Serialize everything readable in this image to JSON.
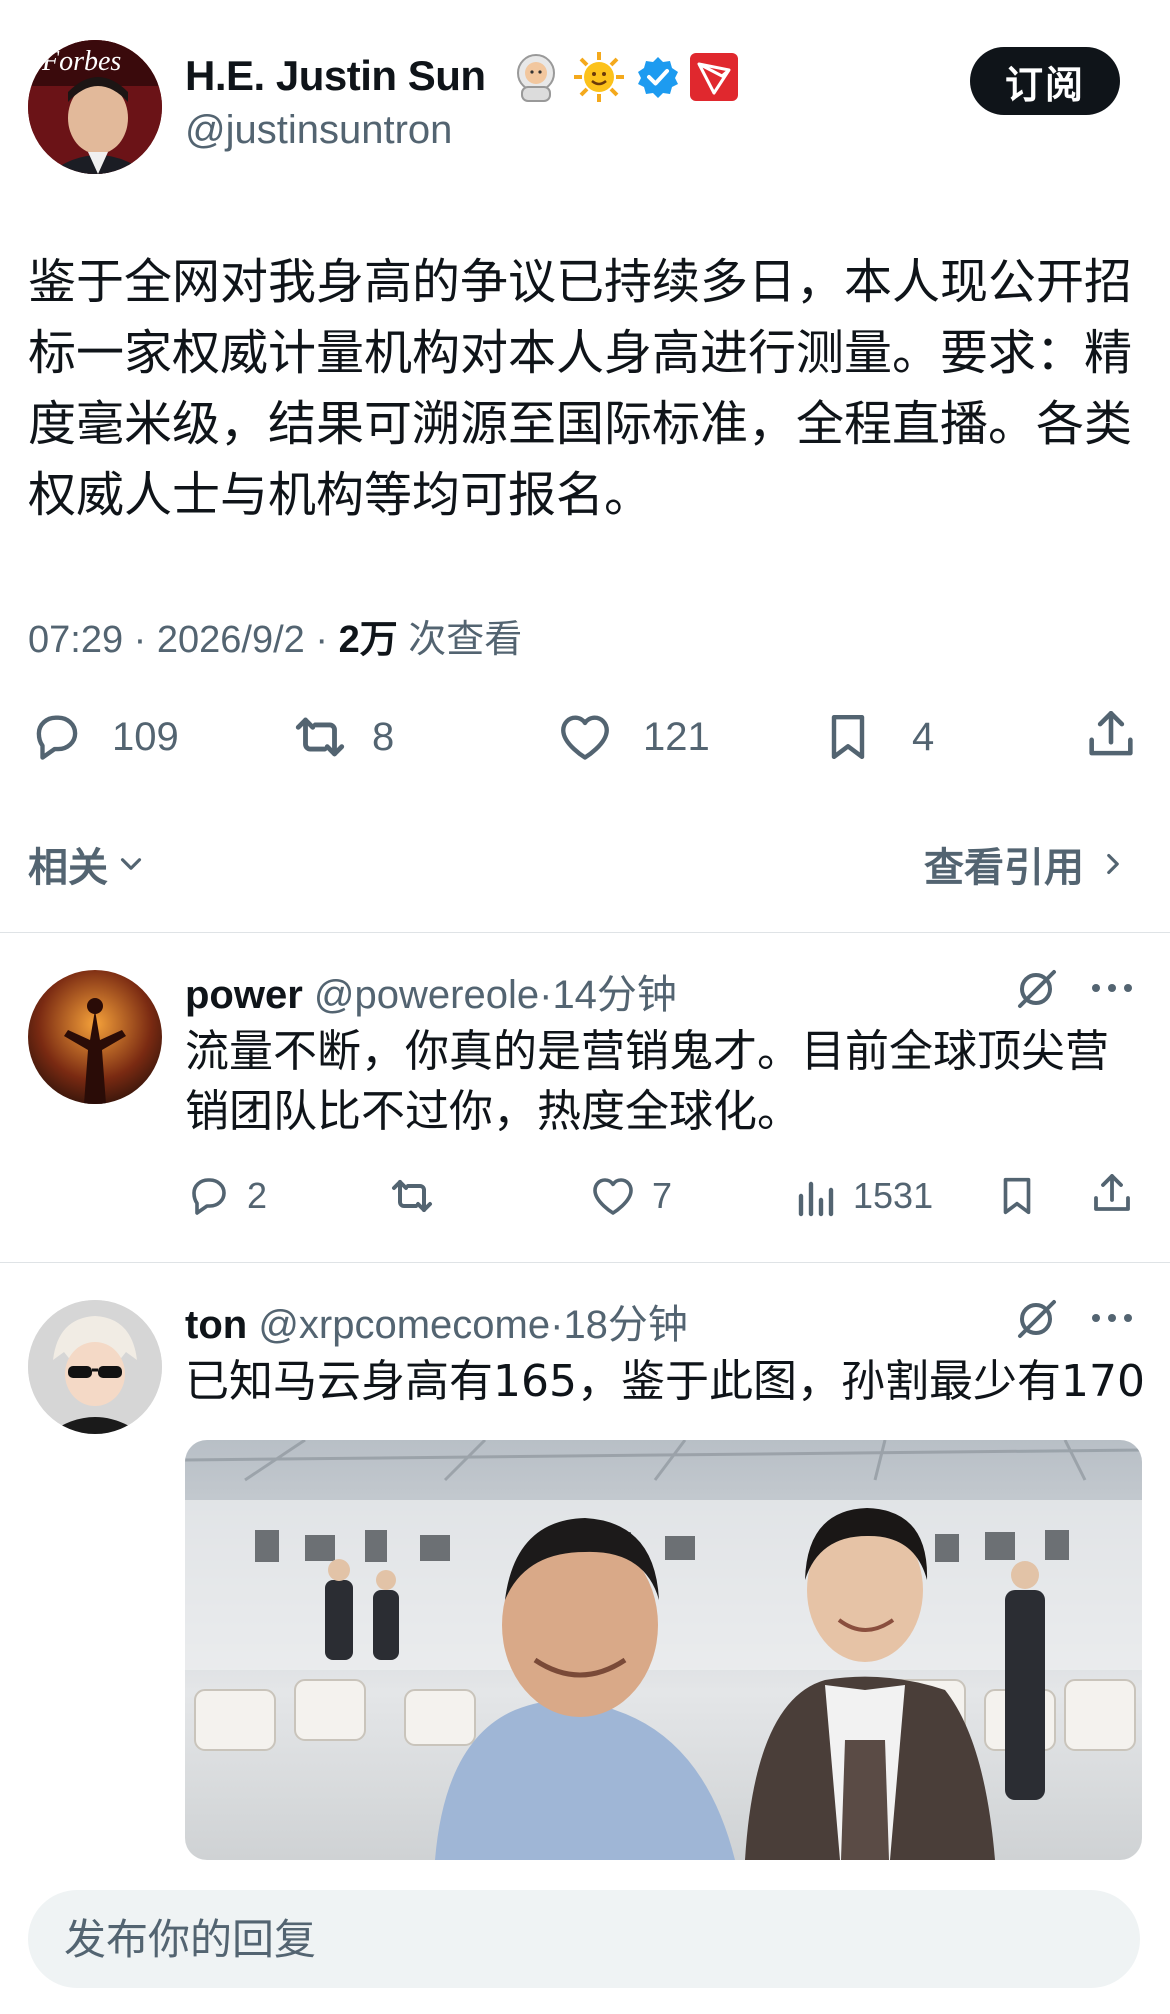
{
  "tweet": {
    "author_name": "H.E. Justin Sun",
    "author_handle": "@justinsuntron",
    "avatar_logo_text": "Forbes",
    "subscribe_label": "订阅",
    "body": "鉴于全网对我身高的争议已持续多日，本人现公开招标一家权威计量机构对本人身高进行测量。要求：精度毫米级，结果可溯源至国际标准，全程直播。各类权威人士与机构等均可报名。",
    "time": "07:29",
    "date": "2026/9/2",
    "views": "2万",
    "views_label": "次查看",
    "replies": "109",
    "retweets": "8",
    "likes": "121",
    "bookmarks": "4",
    "related_label": "相关",
    "view_quotes_label": "查看引用"
  },
  "replies": [
    {
      "name": "power",
      "handle": "@powereole",
      "time": "14分钟",
      "body": "流量不断，你真的是营销鬼才。目前全球顶尖营销团队比不过你，热度全球化。",
      "replies": "2",
      "likes": "7",
      "views": "1531"
    },
    {
      "name": "ton",
      "handle": "@xrpcomecome",
      "time": "18分钟",
      "body": "已知马云身高有165，鉴于此图，孙割最少有170"
    }
  ],
  "composer": {
    "placeholder": "发布你的回复"
  },
  "colors": {
    "text": "#0f1419",
    "secondary": "#536471",
    "verified": "#1d9bf0",
    "tron": "#e0282e",
    "input_bg": "#eff3f4"
  }
}
